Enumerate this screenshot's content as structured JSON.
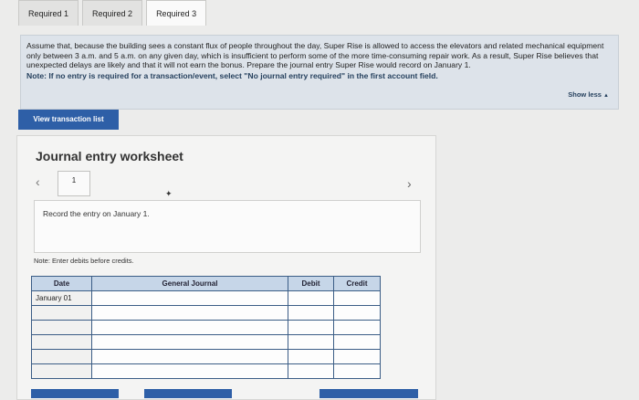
{
  "tabs": [
    {
      "label": "Required 1"
    },
    {
      "label": "Required 2"
    },
    {
      "label": "Required 3"
    }
  ],
  "instructions": {
    "text": "Assume that, because the building sees a constant flux of people throughout the day, Super Rise is allowed to access the elevators and related mechanical equipment only between 3 a.m. and 5 a.m. on any given day, which is insufficient to perform some of the more time-consuming repair work. As a result, Super Rise believes that unexpected delays are likely and that it will not earn the bonus. Prepare the journal entry Super Rise would record on January 1.",
    "note": "Note: If no entry is required for a transaction/event, select \"No journal entry required\" in the first account field.",
    "show_less": "Show less",
    "show_less_icon": "triangle-up-icon"
  },
  "view_transaction_button": "View transaction list",
  "worksheet": {
    "title": "Journal entry worksheet",
    "page": "1",
    "prev_icon": "chevron-left-icon",
    "next_icon": "chevron-right-icon",
    "record_text": "Record the entry on January 1.",
    "note": "Note: Enter debits before credits.",
    "table": {
      "headers": [
        "Date",
        "General Journal",
        "Debit",
        "Credit"
      ],
      "rows": [
        {
          "date": "January 01",
          "account": "",
          "debit": "",
          "credit": ""
        },
        {
          "date": "",
          "account": "",
          "debit": "",
          "credit": ""
        },
        {
          "date": "",
          "account": "",
          "debit": "",
          "credit": ""
        },
        {
          "date": "",
          "account": "",
          "debit": "",
          "credit": ""
        },
        {
          "date": "",
          "account": "",
          "debit": "",
          "credit": ""
        },
        {
          "date": "",
          "account": "",
          "debit": "",
          "credit": ""
        }
      ]
    }
  },
  "colors": {
    "accent_blue": "#2e5fa7",
    "instruction_bg": "#dde3ea",
    "table_header": "#c6d6e8"
  }
}
